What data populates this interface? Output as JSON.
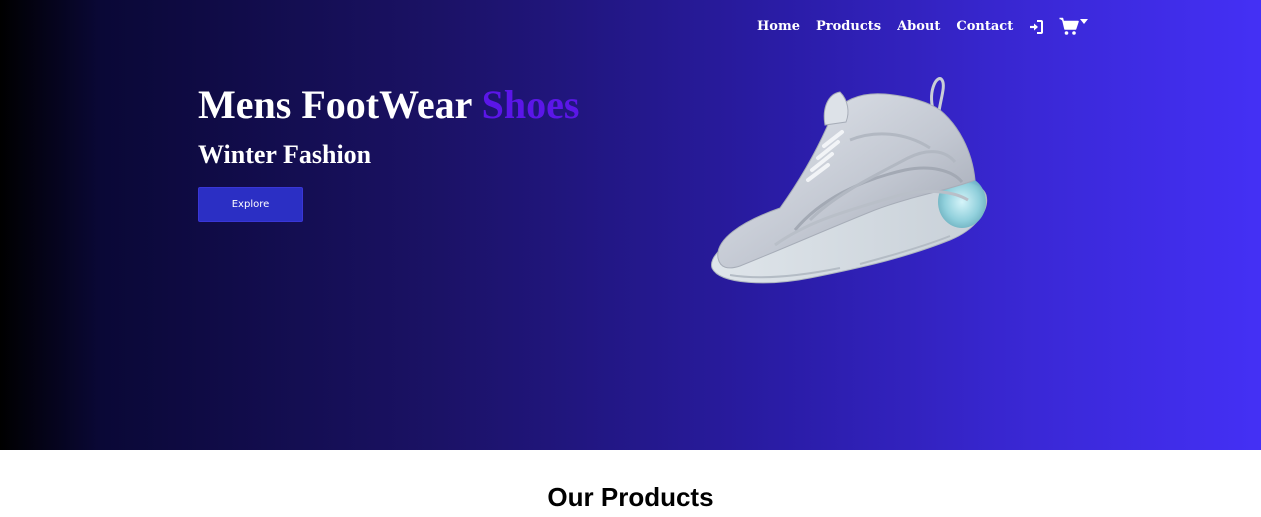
{
  "nav": {
    "items": [
      {
        "label": "Home"
      },
      {
        "label": "Products"
      },
      {
        "label": "About"
      },
      {
        "label": "Contact"
      }
    ],
    "login_icon": "sign-in-icon",
    "cart_icon": "shopping-cart-icon",
    "cart_dropdown_icon": "caret-down-icon"
  },
  "hero": {
    "title_main": "Mens FootWear",
    "title_accent": "Shoes",
    "subtitle": "Winter Fashion",
    "explore_label": "Explore",
    "image": "sneaker-image"
  },
  "colors": {
    "accent": "#5b16e8",
    "button_bg": "#2b2fc4",
    "gradient_start": "#000000",
    "gradient_end": "#4430f5"
  },
  "products": {
    "heading": "Our Products"
  }
}
